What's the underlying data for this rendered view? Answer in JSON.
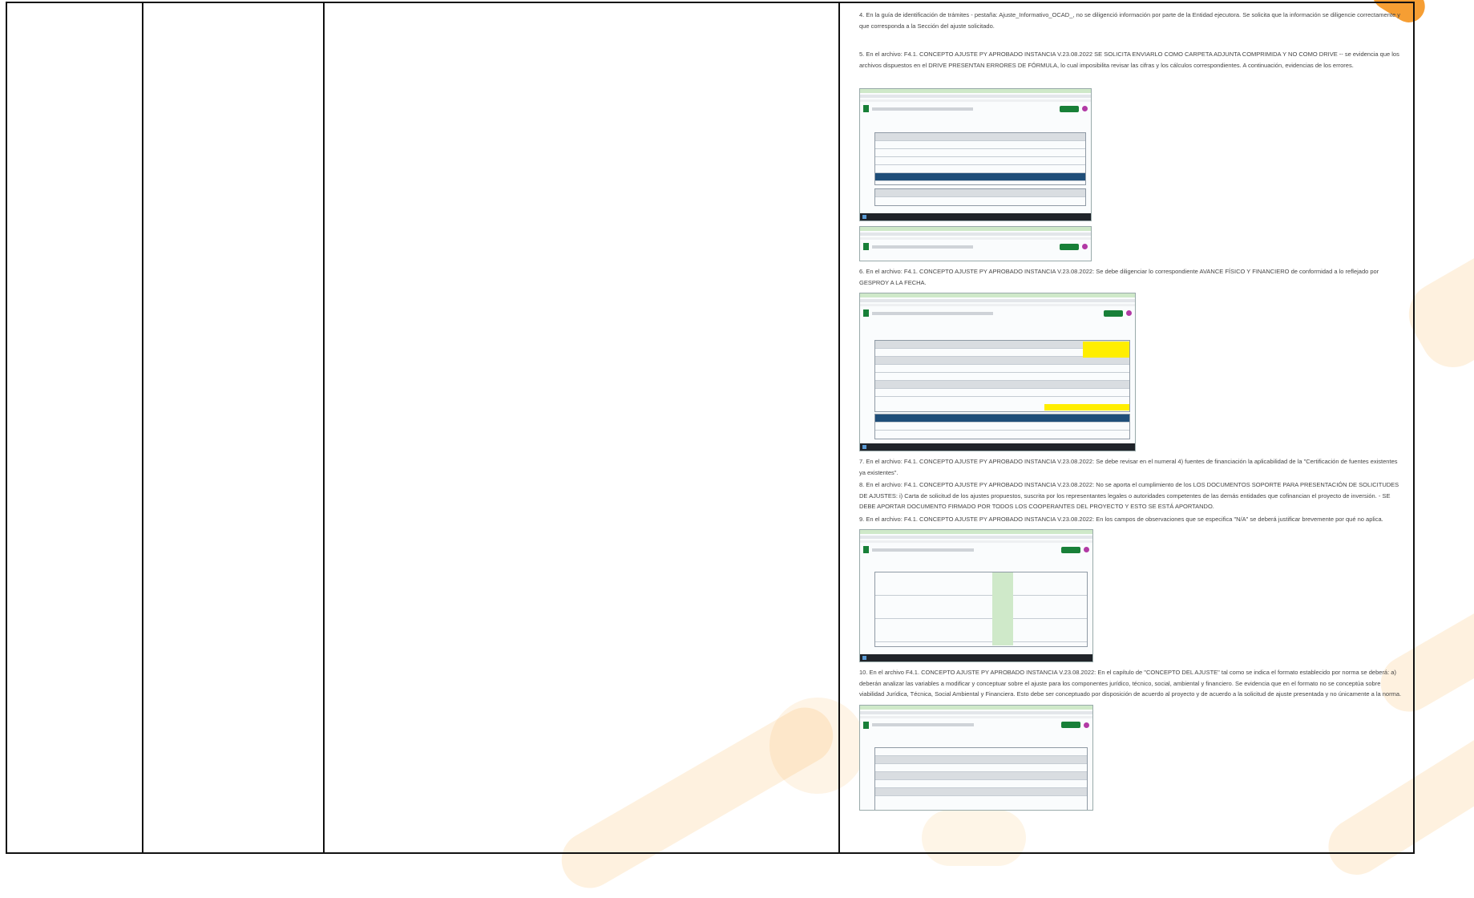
{
  "document": {
    "paragraphs": {
      "p4": "4. En la guía de identificación de trámites - pestaña: Ajuste_Informativo_OCAD_, no se diligenció información por parte de la Entidad ejecutora. Se solicita que la información se diligencie correctamente y que corresponda a la Sección del ajuste solicitado.",
      "p5": "5. En el archivo: F4.1. CONCEPTO AJUSTE PY APROBADO INSTANCIA V.23.08.2022 SE SOLICITA ENVIARLO COMO CARPETA ADJUNTA COMPRIMIDA Y NO COMO DRIVE -- se evidencia que los archivos dispuestos en el DRIVE PRESENTAN ERRORES DE FÓRMULA, lo cual imposibilita revisar las cifras y los cálculos correspondientes. A continuación, evidencias de los errores.",
      "p6": "6. En el archivo: F4.1. CONCEPTO AJUSTE PY APROBADO INSTANCIA V.23.08.2022: Se debe diligenciar lo correspondiente AVANCE FÍSICO Y FINANCIERO de conformidad a lo reflejado por GESPROY A LA FECHA.",
      "p7": "7. En el archivo: F4.1. CONCEPTO AJUSTE PY APROBADO INSTANCIA V.23.08.2022: Se debe revisar en el numeral 4) fuentes de financiación la aplicabilidad de la \"Certificación de fuentes existentes ya existentes\".",
      "p8": "8. En el archivo: F4.1. CONCEPTO AJUSTE PY APROBADO INSTANCIA V.23.08.2022: No se aporta el cumplimiento de los LOS DOCUMENTOS SOPORTE PARA PRESENTACIÓN DE SOLICITUDES DE AJUSTES: i) Carta de solicitud de los ajustes propuestos, suscrita por los representantes legales o autoridades competentes de las demás entidades que cofinancian el proyecto de inversión. - SE DEBE APORTAR DOCUMENTO FIRMADO POR TODOS LOS COOPERANTES DEL PROYECTO Y ESTO SE ESTÁ APORTANDO.",
      "p9": "9. En el archivo: F4.1. CONCEPTO AJUSTE PY APROBADO INSTANCIA V.23.08.2022: En los campos de observaciones que se especifica \"N/A\" se deberá justificar brevemente por qué no aplica.",
      "p10": "10. En el archivo F4.1. CONCEPTO AJUSTE PY APROBADO INSTANCIA V.23.08.2022: En el capítulo de \"CONCEPTO DEL AJUSTE\" tal como se indica el formato establecido por norma se deberá: a) deberán analizar las variables a modificar y conceptuar sobre el ajuste para los componentes jurídico, técnico, social, ambiental y financiero. Se evidencia que en el formato no se conceptúa sobre viabilidad Jurídica, Técnica, Social Ambiental y Financiera. Esto debe ser conceptuado por disposición de acuerdo al proyecto y de acuerdo a la solicitud de ajuste presentada y no únicamente a la norma."
    }
  }
}
